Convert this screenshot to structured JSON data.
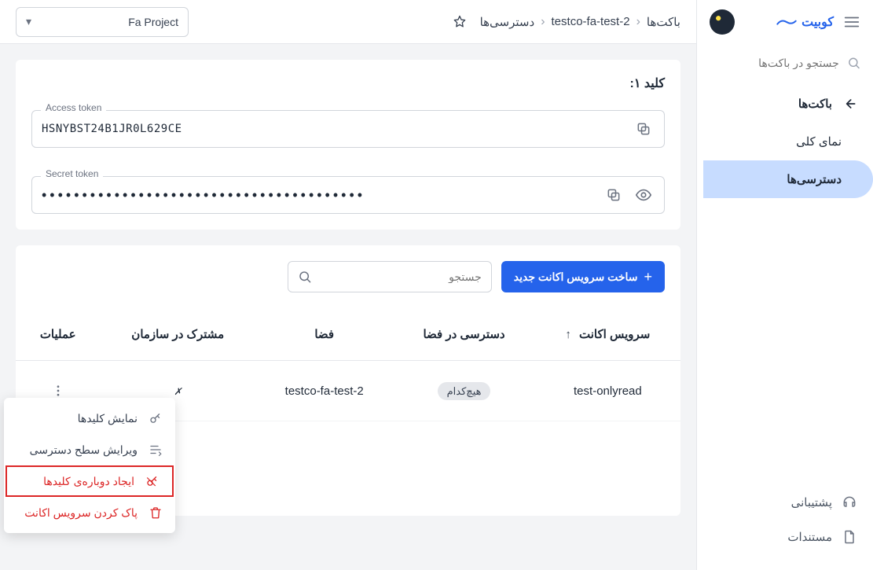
{
  "brand": {
    "name": "کوبیت"
  },
  "sidebar": {
    "search_placeholder": "جستجو در باکت‌ها",
    "nav": {
      "buckets": "باکت‌ها",
      "overview": "نمای کلی",
      "access": "دسترسی‌ها"
    },
    "bottom": {
      "support": "پشتیبانی",
      "docs": "مستندات"
    }
  },
  "topbar": {
    "breadcrumb": [
      "باکت‌ها",
      "testco-fa-test-2",
      "دسترسی‌ها"
    ],
    "project": "Fa Project"
  },
  "key_card": {
    "title": "کلید ۱:",
    "access_label": "Access token",
    "access_value": "HSNYBST24B1JR0L629CE",
    "secret_label": "Secret token",
    "secret_masked": "••••••••••••••••••••••••••••••••••••••••"
  },
  "table": {
    "create_btn": "ساخت سرویس اکانت جدید",
    "search_placeholder": "جستجو",
    "headers": {
      "service_account": "سرویس اکانت",
      "space_access": "دسترسی در فضا",
      "space": "فضا",
      "shared": "مشترک در سازمان",
      "actions": "عملیات"
    },
    "rows": [
      {
        "service_account": "test-onlyread",
        "space_access": "هیچ‌کدام",
        "space": "testco-fa-test-2",
        "shared": "✗"
      }
    ]
  },
  "context_menu": {
    "show_keys": "نمایش کلیدها",
    "edit_access": "ویرایش سطح دسترسی",
    "regen_keys": "ایجاد دوباره‌ی کلیدها",
    "delete": "پاک کردن سرویس اکانت"
  }
}
